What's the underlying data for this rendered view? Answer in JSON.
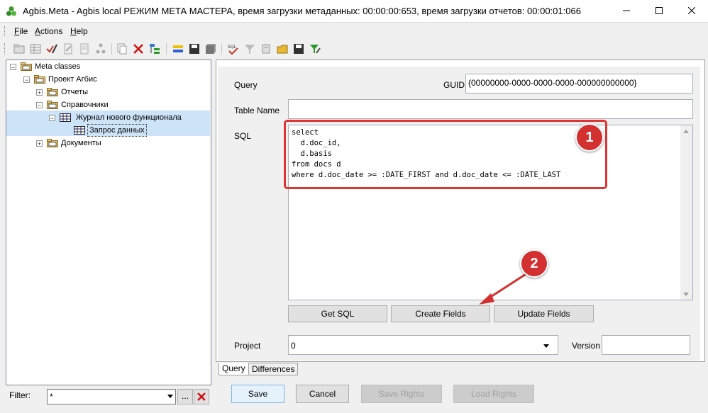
{
  "window": {
    "title": "Agbis.Meta - Agbis local РЕЖИМ МЕТА МАСТЕРА, время загрузки метаданных: 00:00:00:653, время загрузки отчетов: 00:00:01:066",
    "controls": [
      "minimize-icon",
      "maximize-icon",
      "close-icon"
    ]
  },
  "menu": {
    "items": [
      {
        "label": "File",
        "key": "F",
        "rest": "ile"
      },
      {
        "label": "Actions",
        "key": "A",
        "rest": "ctions"
      },
      {
        "label": "Help",
        "key": "H",
        "rest": "elp"
      }
    ]
  },
  "toolbar": {
    "icons": [
      "new-folder-icon",
      "table-icon",
      "edit-icon",
      "doc-edit-icon",
      "doc-icon",
      "hierarchy-icon",
      "copy-icon",
      "delete-icon",
      "tree-icon",
      "swap-icon",
      "save-icon",
      "save-all-icon",
      "sql-check-icon",
      "filter-icon",
      "export-icon",
      "open-folder-icon",
      "save-icon-2",
      "filter-tool-icon"
    ]
  },
  "tree": {
    "items": [
      {
        "label": "Meta classes",
        "expander": "−",
        "level": 0
      },
      {
        "label": "Проект Агбис",
        "expander": "−",
        "level": 1
      },
      {
        "label": "Отчеты",
        "expander": "+",
        "level": 2
      },
      {
        "label": "Справочники",
        "expander": "−",
        "level": 2
      },
      {
        "label": "Журнал нового функционала",
        "expander": "−",
        "level": 3
      },
      {
        "label": "Запрос данных",
        "expander": "",
        "level": 4
      },
      {
        "label": "Документы",
        "expander": "+",
        "level": 2
      }
    ]
  },
  "filter": {
    "label": "Filter:",
    "value": "*",
    "browse_label": "..."
  },
  "form": {
    "query_label": "Query",
    "guid_label": "GUID",
    "guid_value": "{00000000-0000-0000-0000-000000000000}",
    "table_name_label": "Table Name",
    "table_name_value": "",
    "sql_label": "SQL",
    "sql_value": "select\n  d.doc_id,\n  d.basis\nfrom docs d\nwhere d.doc_date >= :DATE_FIRST and d.doc_date <= :DATE_LAST",
    "buttons": {
      "get_sql": "Get SQL",
      "create_fields": "Create Fields",
      "update_fields": "Update Fields"
    },
    "project_label": "Project",
    "project_value": "0",
    "version_label": "Version",
    "version_value": ""
  },
  "tabs": [
    {
      "label": "Query",
      "active": true
    },
    {
      "label": "Differences",
      "active": false
    }
  ],
  "footer": {
    "save": "Save",
    "cancel": "Cancel",
    "save_rights": "Save Rights",
    "load_rights": "Load Rights"
  },
  "annotations": {
    "badge1": "1",
    "badge2": "2",
    "color": "#d33131"
  }
}
